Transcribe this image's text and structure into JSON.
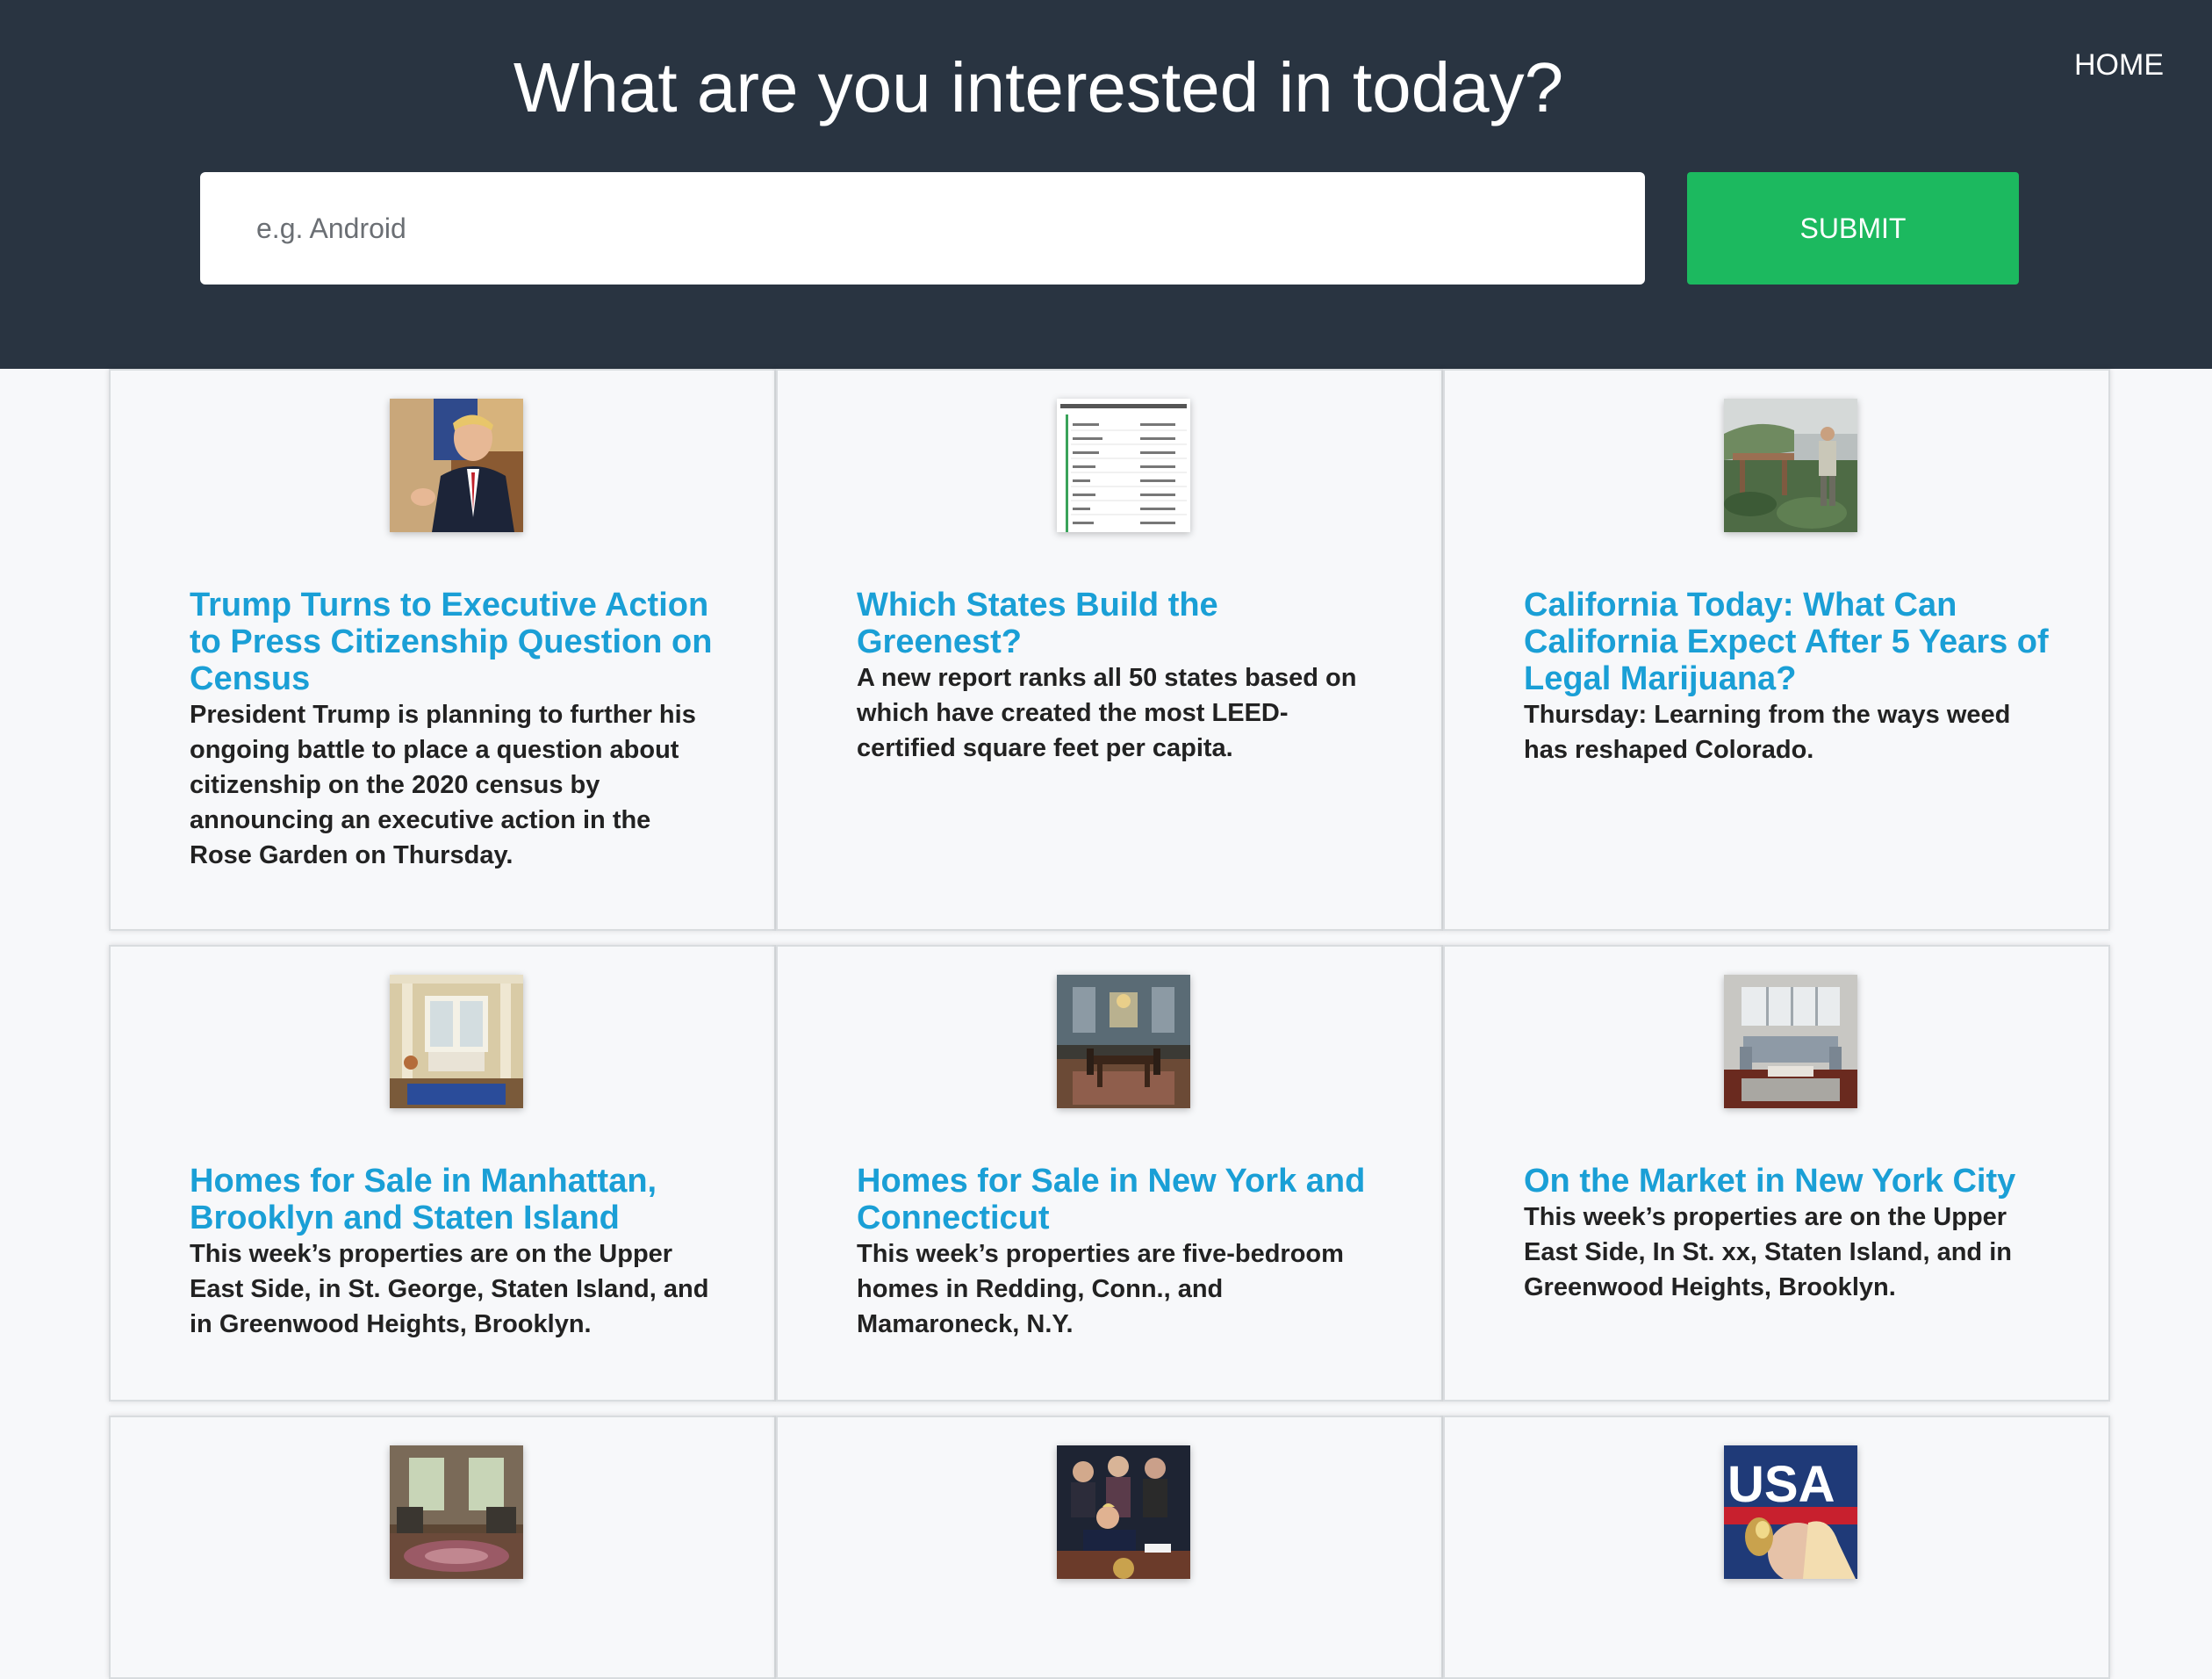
{
  "header": {
    "headline": "What are you interested in today?",
    "home_label": "HOME"
  },
  "search": {
    "placeholder": "e.g. Android",
    "value": "",
    "submit_label": "SUBMIT"
  },
  "colors": {
    "header_bg": "#293441",
    "submit_bg": "#1cb95f",
    "title_link": "#1a9fd6",
    "page_bg": "#f7f8fa"
  },
  "cards": [
    {
      "title": "Trump Turns to Executive Action to Press Citizenship Question on Census",
      "description": "President Trump is planning to further his ongoing battle to place a question about citizenship on the 2020 census by announcing an executive action in the Rose Garden on Thursday.",
      "image": "photo-trump-speaking"
    },
    {
      "title": "Which States Build the Greenest?",
      "description": "A new report ranks all 50 states based on which have created the most LEED-certified square feet per capita.",
      "image": "table-leed-certification"
    },
    {
      "title": "California Today: What Can California Expect After 5 Years of Legal Marijuana?",
      "description": "Thursday: Learning from the ways weed has reshaped Colorado.",
      "image": "photo-greenhouse-worker"
    },
    {
      "title": "Homes for Sale in Manhattan, Brooklyn and Staten Island",
      "description": "This week’s properties are on the Upper East Side, in St. George, Staten Island, and in Greenwood Heights, Brooklyn.",
      "image": "photo-living-room-bay-window"
    },
    {
      "title": "Homes for Sale in New York and Connecticut",
      "description": "This week’s properties are five-bedroom homes in Redding, Conn., and Mamaroneck, N.Y.",
      "image": "photo-dining-room"
    },
    {
      "title": "On the Market in New York City",
      "description": "This week’s properties are on the Upper East Side, In St. xx, Staten Island, and in Greenwood Heights, Brooklyn.",
      "image": "photo-modern-living-room"
    },
    {
      "title": "",
      "description": "",
      "image": "photo-sitting-room-rug"
    },
    {
      "title": "",
      "description": "",
      "image": "photo-signing-ceremony"
    },
    {
      "title": "",
      "description": "",
      "image": "photo-usa-athlete-trophy"
    }
  ]
}
